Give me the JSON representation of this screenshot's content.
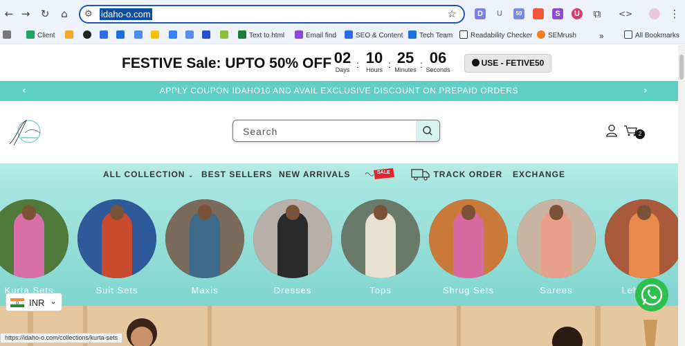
{
  "browser": {
    "url": "idaho-o.com",
    "extensions": [
      "D",
      "U",
      "59",
      "S",
      "U"
    ],
    "bookmarks": [
      "Client",
      "Text to html",
      "Email find",
      "SEO & Content",
      "Tech Team",
      "Readability Checker",
      "SEMrush"
    ],
    "all_bookmarks": "All Bookmarks",
    "status_url": "https://idaho-o.com/collections/kurta-sets"
  },
  "sale_bar": {
    "title": "FESTIVE Sale: UPTO 50% OFF",
    "countdown": [
      {
        "value": "02",
        "unit": "Days"
      },
      {
        "value": "10",
        "unit": "Hours"
      },
      {
        "value": "25",
        "unit": "Minutes"
      },
      {
        "value": "06",
        "unit": "Seconds"
      }
    ],
    "coupon_label": "USE - FETIVE50"
  },
  "announcement": {
    "text": "APPLY COUPON IDAHO10 AND AVAIL EXCLUSIVE DISCOUNT ON PREPAID ORDERS"
  },
  "header": {
    "search_placeholder": "Search",
    "cart_count": "2"
  },
  "nav": {
    "all_collection": "ALL COLLECTION",
    "best_sellers": "BEST SELLERS",
    "new_arrivals": "NEW ARRIVALS",
    "sale_tag": "SALE",
    "track_order": "TRACK ORDER",
    "exchange": "EXCHANGE"
  },
  "collections": [
    {
      "label": "Kurta Sets",
      "bg": "#4f7a3a",
      "dress": "#d96fa8"
    },
    {
      "label": "Suit Sets",
      "bg": "#2e5a9c",
      "dress": "#c94b2f"
    },
    {
      "label": "Maxis",
      "bg": "#7a6a5a",
      "dress": "#3e6a8a"
    },
    {
      "label": "Dresses",
      "bg": "#b8b0a8",
      "dress": "#2a2a2a"
    },
    {
      "label": "Tops",
      "bg": "#6a7a6a",
      "dress": "#e8e0d0"
    },
    {
      "label": "Shrug Sets",
      "bg": "#c97a3a",
      "dress": "#d76aa0"
    },
    {
      "label": "Sarees",
      "bg": "#c8b4a0",
      "dress": "#e8a08a"
    },
    {
      "label": "Lehengas",
      "bg": "#a85a3a",
      "dress": "#e88a4a"
    }
  ],
  "currency": {
    "code": "INR"
  }
}
